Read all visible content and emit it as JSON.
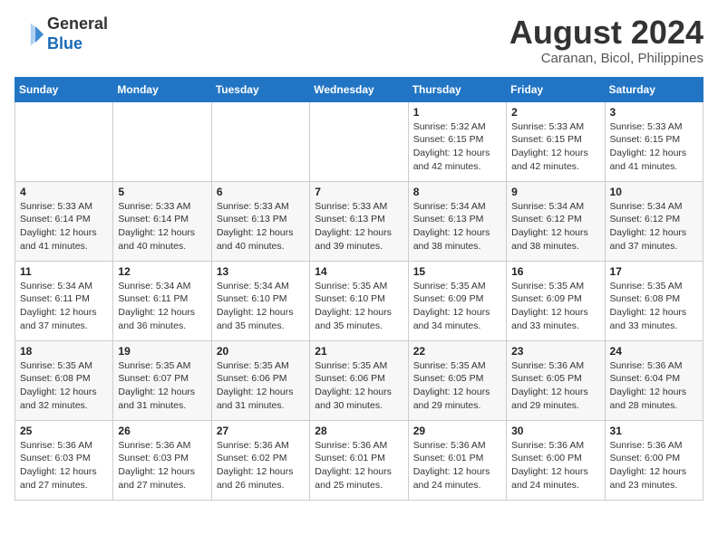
{
  "header": {
    "logo_line1": "General",
    "logo_line2": "Blue",
    "title": "August 2024",
    "subtitle": "Caranan, Bicol, Philippines"
  },
  "weekdays": [
    "Sunday",
    "Monday",
    "Tuesday",
    "Wednesday",
    "Thursday",
    "Friday",
    "Saturday"
  ],
  "weeks": [
    [
      {
        "day": "",
        "info": ""
      },
      {
        "day": "",
        "info": ""
      },
      {
        "day": "",
        "info": ""
      },
      {
        "day": "",
        "info": ""
      },
      {
        "day": "1",
        "info": "Sunrise: 5:32 AM\nSunset: 6:15 PM\nDaylight: 12 hours\nand 42 minutes."
      },
      {
        "day": "2",
        "info": "Sunrise: 5:33 AM\nSunset: 6:15 PM\nDaylight: 12 hours\nand 42 minutes."
      },
      {
        "day": "3",
        "info": "Sunrise: 5:33 AM\nSunset: 6:15 PM\nDaylight: 12 hours\nand 41 minutes."
      }
    ],
    [
      {
        "day": "4",
        "info": "Sunrise: 5:33 AM\nSunset: 6:14 PM\nDaylight: 12 hours\nand 41 minutes."
      },
      {
        "day": "5",
        "info": "Sunrise: 5:33 AM\nSunset: 6:14 PM\nDaylight: 12 hours\nand 40 minutes."
      },
      {
        "day": "6",
        "info": "Sunrise: 5:33 AM\nSunset: 6:13 PM\nDaylight: 12 hours\nand 40 minutes."
      },
      {
        "day": "7",
        "info": "Sunrise: 5:33 AM\nSunset: 6:13 PM\nDaylight: 12 hours\nand 39 minutes."
      },
      {
        "day": "8",
        "info": "Sunrise: 5:34 AM\nSunset: 6:13 PM\nDaylight: 12 hours\nand 38 minutes."
      },
      {
        "day": "9",
        "info": "Sunrise: 5:34 AM\nSunset: 6:12 PM\nDaylight: 12 hours\nand 38 minutes."
      },
      {
        "day": "10",
        "info": "Sunrise: 5:34 AM\nSunset: 6:12 PM\nDaylight: 12 hours\nand 37 minutes."
      }
    ],
    [
      {
        "day": "11",
        "info": "Sunrise: 5:34 AM\nSunset: 6:11 PM\nDaylight: 12 hours\nand 37 minutes."
      },
      {
        "day": "12",
        "info": "Sunrise: 5:34 AM\nSunset: 6:11 PM\nDaylight: 12 hours\nand 36 minutes."
      },
      {
        "day": "13",
        "info": "Sunrise: 5:34 AM\nSunset: 6:10 PM\nDaylight: 12 hours\nand 35 minutes."
      },
      {
        "day": "14",
        "info": "Sunrise: 5:35 AM\nSunset: 6:10 PM\nDaylight: 12 hours\nand 35 minutes."
      },
      {
        "day": "15",
        "info": "Sunrise: 5:35 AM\nSunset: 6:09 PM\nDaylight: 12 hours\nand 34 minutes."
      },
      {
        "day": "16",
        "info": "Sunrise: 5:35 AM\nSunset: 6:09 PM\nDaylight: 12 hours\nand 33 minutes."
      },
      {
        "day": "17",
        "info": "Sunrise: 5:35 AM\nSunset: 6:08 PM\nDaylight: 12 hours\nand 33 minutes."
      }
    ],
    [
      {
        "day": "18",
        "info": "Sunrise: 5:35 AM\nSunset: 6:08 PM\nDaylight: 12 hours\nand 32 minutes."
      },
      {
        "day": "19",
        "info": "Sunrise: 5:35 AM\nSunset: 6:07 PM\nDaylight: 12 hours\nand 31 minutes."
      },
      {
        "day": "20",
        "info": "Sunrise: 5:35 AM\nSunset: 6:06 PM\nDaylight: 12 hours\nand 31 minutes."
      },
      {
        "day": "21",
        "info": "Sunrise: 5:35 AM\nSunset: 6:06 PM\nDaylight: 12 hours\nand 30 minutes."
      },
      {
        "day": "22",
        "info": "Sunrise: 5:35 AM\nSunset: 6:05 PM\nDaylight: 12 hours\nand 29 minutes."
      },
      {
        "day": "23",
        "info": "Sunrise: 5:36 AM\nSunset: 6:05 PM\nDaylight: 12 hours\nand 29 minutes."
      },
      {
        "day": "24",
        "info": "Sunrise: 5:36 AM\nSunset: 6:04 PM\nDaylight: 12 hours\nand 28 minutes."
      }
    ],
    [
      {
        "day": "25",
        "info": "Sunrise: 5:36 AM\nSunset: 6:03 PM\nDaylight: 12 hours\nand 27 minutes."
      },
      {
        "day": "26",
        "info": "Sunrise: 5:36 AM\nSunset: 6:03 PM\nDaylight: 12 hours\nand 27 minutes."
      },
      {
        "day": "27",
        "info": "Sunrise: 5:36 AM\nSunset: 6:02 PM\nDaylight: 12 hours\nand 26 minutes."
      },
      {
        "day": "28",
        "info": "Sunrise: 5:36 AM\nSunset: 6:01 PM\nDaylight: 12 hours\nand 25 minutes."
      },
      {
        "day": "29",
        "info": "Sunrise: 5:36 AM\nSunset: 6:01 PM\nDaylight: 12 hours\nand 24 minutes."
      },
      {
        "day": "30",
        "info": "Sunrise: 5:36 AM\nSunset: 6:00 PM\nDaylight: 12 hours\nand 24 minutes."
      },
      {
        "day": "31",
        "info": "Sunrise: 5:36 AM\nSunset: 6:00 PM\nDaylight: 12 hours\nand 23 minutes."
      }
    ]
  ]
}
